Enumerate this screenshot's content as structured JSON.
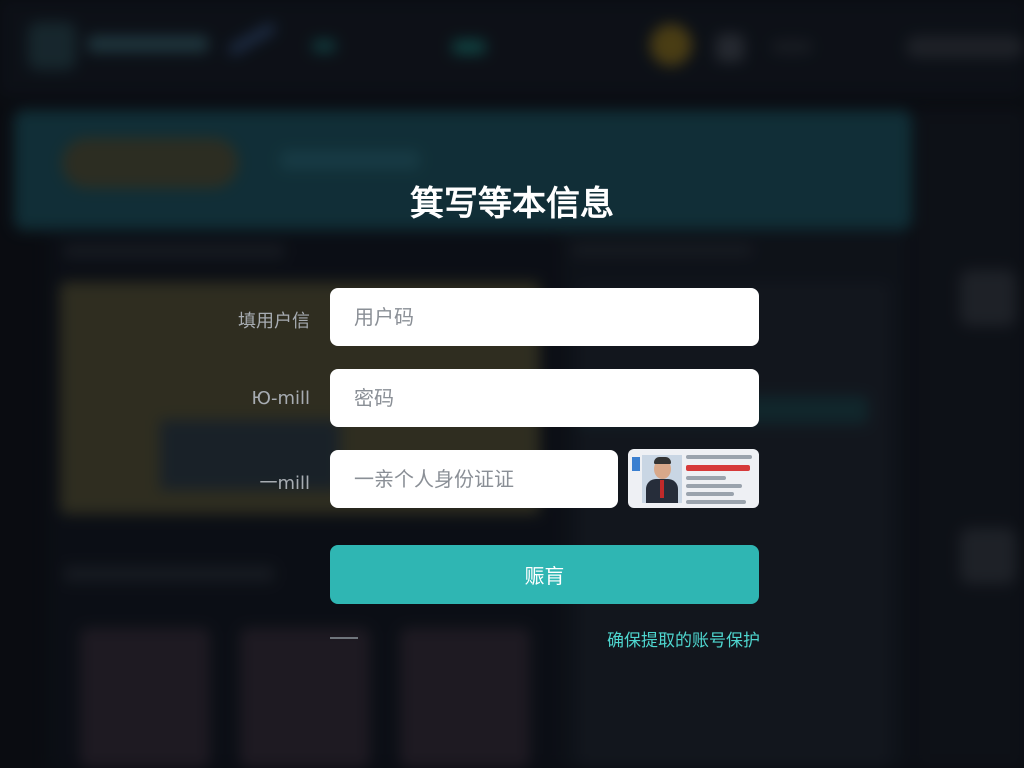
{
  "modal": {
    "title": "箕写等本信息",
    "fields": [
      {
        "label": "填用户信",
        "placeholder": "用户码"
      },
      {
        "label": "Ю‑mill",
        "placeholder": "密码"
      },
      {
        "label": "一mill",
        "placeholder": "一亲个人身份证证"
      }
    ],
    "submit_label": "赈肓",
    "protect_link": "确保提取的账号保护"
  },
  "colors": {
    "accent": "#2fb6b3",
    "link": "#4ed6cf",
    "overlay": "#080a0e"
  },
  "icons": [
    "id-card-thumbnail-icon"
  ]
}
